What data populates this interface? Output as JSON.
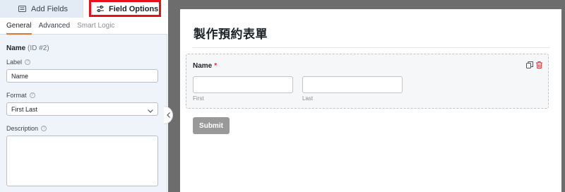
{
  "top_tabs": {
    "add_fields": "Add Fields",
    "field_options": "Field Options"
  },
  "sub_tabs": [
    "General",
    "Advanced",
    "Smart Logic"
  ],
  "field_options": {
    "field_name": "Name",
    "field_id": "(ID #2)",
    "label_label": "Label",
    "label_value": "Name",
    "format_label": "Format",
    "format_value": "First Last",
    "description_label": "Description",
    "help_glyph": "?"
  },
  "form": {
    "title": "製作預約表單",
    "field_label": "Name",
    "required_marker": "*",
    "first_caption": "First",
    "last_caption": "Last",
    "submit_label": "Submit"
  },
  "colors": {
    "highlight": "#e8101a",
    "accent_tab_underline": "#e27730",
    "required": "#d63638",
    "delete_icon": "#d63638",
    "canvas_background": "#6d6d6d",
    "submit_background": "#999999"
  },
  "icons": {
    "add_fields_tab": "list-form-icon",
    "field_options_tab": "sliders-icon",
    "format_select": "chevron-down-icon",
    "collapse_handle": "chevron-left-icon",
    "duplicate_action": "duplicate-icon",
    "delete_action": "trash-icon"
  }
}
